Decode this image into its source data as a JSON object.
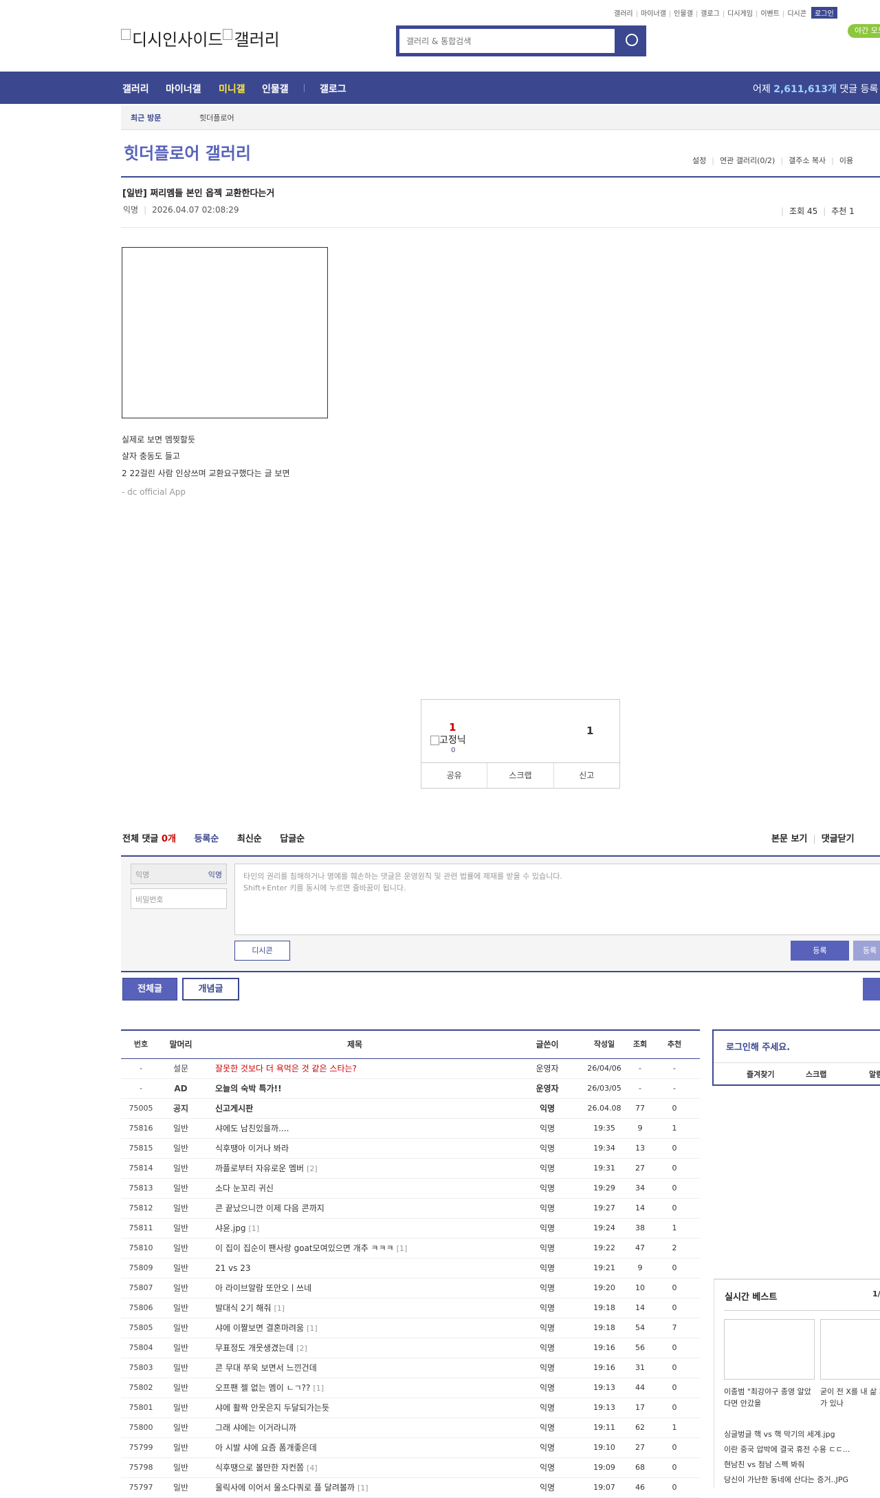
{
  "top_links": [
    "갤러리",
    "마이너갤",
    "인물갤",
    "갤로그",
    "디시게임",
    "이벤트",
    "디시콘"
  ],
  "login_label": "로그인",
  "night_label": "야간 모드",
  "logo_alt": "디시인사이드",
  "logo_alt2": "갤러리",
  "search_placeholder": "갤러리 & 통합검색",
  "nav": {
    "items": [
      "갤러리",
      "마이너갤",
      "미니갤",
      "인물갤",
      "갤로그"
    ],
    "right_prefix": "어제 ",
    "right_count": "2,611,613개",
    "right_suffix": " 댓글 등록"
  },
  "recent": {
    "label": "최근 방문",
    "item": "힛더플로어"
  },
  "gallery_title": "힛더플로어 갤러리",
  "gallery_tools": [
    "설정",
    "연관 갤러리(0/2)",
    "갤주소 복사",
    "이용"
  ],
  "post": {
    "title": "[일반] 쩌리멤들 본인 옵젝 교환한다는거",
    "author": "익명",
    "date": "2026.04.07 02:08:29",
    "views": "조회 45",
    "recommends": "추천 1",
    "body": [
      "실제로 보면 멤찢할듯",
      "살자 충동도 들고",
      "2  22걸린 사람 인상쓰며 교환요구했다는 글 보면"
    ],
    "signature": "- dc official App"
  },
  "recommend": {
    "up": "1",
    "img_alt": "고정닉",
    "sub": "0",
    "down": "1",
    "buttons": [
      "공유",
      "스크랩",
      "신고"
    ]
  },
  "comments": {
    "label": "전체 댓글",
    "count": "0개",
    "tabs": [
      "등록순",
      "최신순",
      "답글순"
    ],
    "right": [
      "본문 보기",
      "댓글닫기"
    ],
    "nick_placeholder": "익명",
    "nick_tag": "익명",
    "pw_placeholder": "비밀번호",
    "text_placeholder1": "타인의 권리를 침해하거나 명예를 훼손하는 댓글은 운영원칙 및 관련 법률에 제재를 받을 수 있습니다.",
    "text_placeholder2": "Shift+Enter 키를 동시에 누르면 줄바꿈이 됩니다.",
    "dccon": "디시콘",
    "submit": "등록",
    "submit2": "등록"
  },
  "board_buttons": {
    "all": "전체글",
    "hot": "개념글"
  },
  "list": {
    "headers": {
      "num": "번호",
      "head": "말머리",
      "title": "제목",
      "writer": "글쓴이",
      "date": "작성일",
      "view": "조회",
      "rec": "추천"
    },
    "rows": [
      {
        "num": "-",
        "head": "설문",
        "title": "잘못한 것보다 더 욕먹은 것 같은 스타는?",
        "cc": "",
        "writer": "운영자",
        "date": "26/04/06",
        "view": "-",
        "rec": "-",
        "type": "survey"
      },
      {
        "num": "-",
        "head": "AD",
        "title": "오늘의 숙박 특가!!",
        "cc": "",
        "writer": "운영자",
        "date": "26/03/05",
        "view": "-",
        "rec": "-",
        "type": "notice"
      },
      {
        "num": "75005",
        "head": "공지",
        "title": "신고게시판",
        "cc": "",
        "writer": "익명",
        "date": "26.04.08",
        "view": "77",
        "rec": "0",
        "type": "notice"
      },
      {
        "num": "75816",
        "head": "일반",
        "title": "샤에도 남친있을까....",
        "cc": "",
        "writer": "익명",
        "date": "19:35",
        "view": "9",
        "rec": "1",
        "type": ""
      },
      {
        "num": "75815",
        "head": "일반",
        "title": "식후땡아 이거나 봐라",
        "cc": "",
        "writer": "익명",
        "date": "19:34",
        "view": "13",
        "rec": "0",
        "type": ""
      },
      {
        "num": "75814",
        "head": "일반",
        "title": "까플로부터 자유로운 멤버",
        "cc": "[2]",
        "writer": "익명",
        "date": "19:31",
        "view": "27",
        "rec": "0",
        "type": ""
      },
      {
        "num": "75813",
        "head": "일반",
        "title": "소다 눈꼬리 귀신",
        "cc": "",
        "writer": "익명",
        "date": "19:29",
        "view": "34",
        "rec": "0",
        "type": ""
      },
      {
        "num": "75812",
        "head": "일반",
        "title": "콘 끝났으니깐 이제 다음 콘까지",
        "cc": "",
        "writer": "익명",
        "date": "19:27",
        "view": "14",
        "rec": "0",
        "type": ""
      },
      {
        "num": "75811",
        "head": "일반",
        "title": "샤윤.jpg",
        "cc": "[1]",
        "writer": "익명",
        "date": "19:24",
        "view": "38",
        "rec": "1",
        "type": ""
      },
      {
        "num": "75810",
        "head": "일반",
        "title": "이 집이 집순이 팬사랑 goat모여있으면 개추 ㅋㅋㅋ",
        "cc": "[1]",
        "writer": "익명",
        "date": "19:22",
        "view": "47",
        "rec": "2",
        "type": ""
      },
      {
        "num": "75809",
        "head": "일반",
        "title": "21 vs 23",
        "cc": "",
        "writer": "익명",
        "date": "19:21",
        "view": "9",
        "rec": "0",
        "type": ""
      },
      {
        "num": "75807",
        "head": "일반",
        "title": "아 라이브알람 또안오ㅣ쓰네",
        "cc": "",
        "writer": "익명",
        "date": "19:20",
        "view": "10",
        "rec": "0",
        "type": ""
      },
      {
        "num": "75806",
        "head": "일반",
        "title": "발대식 2기 해줘",
        "cc": "[1]",
        "writer": "익명",
        "date": "19:18",
        "view": "14",
        "rec": "0",
        "type": ""
      },
      {
        "num": "75805",
        "head": "일반",
        "title": "샤에 이짤보면 결혼마려움",
        "cc": "[1]",
        "writer": "익명",
        "date": "19:18",
        "view": "54",
        "rec": "7",
        "type": ""
      },
      {
        "num": "75804",
        "head": "일반",
        "title": "무표정도 개웃생겼는데",
        "cc": "[2]",
        "writer": "익명",
        "date": "19:16",
        "view": "56",
        "rec": "0",
        "type": ""
      },
      {
        "num": "75803",
        "head": "일반",
        "title": "콘 무대 쭈욱 보면서 느낀건데",
        "cc": "",
        "writer": "익명",
        "date": "19:16",
        "view": "31",
        "rec": "0",
        "type": ""
      },
      {
        "num": "75802",
        "head": "일반",
        "title": "오프팬 젤 없는 멤이 ㄴㄱ??",
        "cc": "[1]",
        "writer": "익명",
        "date": "19:13",
        "view": "44",
        "rec": "0",
        "type": ""
      },
      {
        "num": "75801",
        "head": "일반",
        "title": "샤에 활짝 안웃은지 두달되가는듯",
        "cc": "",
        "writer": "익명",
        "date": "19:13",
        "view": "17",
        "rec": "0",
        "type": ""
      },
      {
        "num": "75800",
        "head": "일반",
        "title": "그래 샤에는 이거라니까",
        "cc": "",
        "writer": "익명",
        "date": "19:11",
        "view": "62",
        "rec": "1",
        "type": ""
      },
      {
        "num": "75799",
        "head": "일반",
        "title": "아 시발 샤에 요즘 폼개좋은데",
        "cc": "",
        "writer": "익명",
        "date": "19:10",
        "view": "27",
        "rec": "0",
        "type": ""
      },
      {
        "num": "75798",
        "head": "일반",
        "title": "식후땡으로 볼만한 자컨쫌",
        "cc": "[4]",
        "writer": "익명",
        "date": "19:09",
        "view": "68",
        "rec": "0",
        "type": ""
      },
      {
        "num": "75797",
        "head": "일반",
        "title": "울릭사에 이어서 울소다쿼로 플 달려볼까",
        "cc": "[1]",
        "writer": "익명",
        "date": "19:07",
        "view": "46",
        "rec": "0",
        "type": ""
      }
    ]
  },
  "sidebar": {
    "login_title": "로그인해 주세요.",
    "login_tabs": [
      "즐겨찾기",
      "스크랩",
      "알림"
    ],
    "best_title": "실시간 베스트",
    "best_page": "1/",
    "best_caps": [
      "이종범 \"최강야구 종영 알았다면 안갔을",
      "굳이 전 X를 내 삶 지울 필요가 있나"
    ],
    "best_list": [
      "싱글벙글 핵 vs 핵 막기의 세계.jpg",
      "이란 중국 압박에 결국 휴전 수용 ㄷㄷ...",
      "현남친 vs 첨남 스펙 봐줘",
      "당신이 가난한 동네에 산다는 증거..JPG"
    ]
  }
}
